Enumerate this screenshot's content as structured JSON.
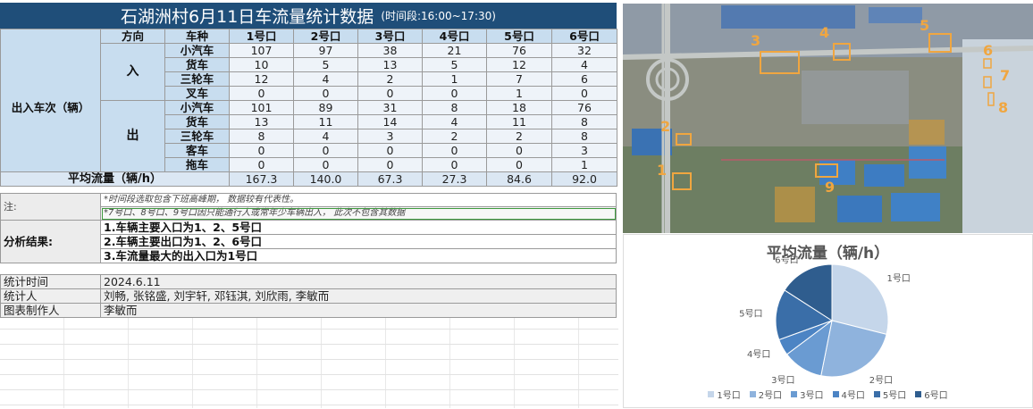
{
  "title": "石湖洲村6月11日车流量统计数据",
  "subtitle": "(时间段:16:00~17:30)",
  "table": {
    "col_direction": "方向",
    "col_type": "车种",
    "gates": [
      "1号口",
      "2号口",
      "3号口",
      "4号口",
      "5号口",
      "6号口"
    ],
    "group_label": "出入车次（辆）",
    "in_label": "入",
    "out_label": "出",
    "in_rows": [
      {
        "type": "小汽车",
        "values": [
          "107",
          "97",
          "38",
          "21",
          "76",
          "32"
        ]
      },
      {
        "type": "货车",
        "values": [
          "10",
          "5",
          "13",
          "5",
          "12",
          "4"
        ]
      },
      {
        "type": "三轮车",
        "values": [
          "12",
          "4",
          "2",
          "1",
          "7",
          "6"
        ]
      },
      {
        "type": "叉车",
        "values": [
          "0",
          "0",
          "0",
          "0",
          "1",
          "0"
        ]
      }
    ],
    "out_rows": [
      {
        "type": "小汽车",
        "values": [
          "101",
          "89",
          "31",
          "8",
          "18",
          "76"
        ]
      },
      {
        "type": "货车",
        "values": [
          "13",
          "11",
          "14",
          "4",
          "11",
          "8"
        ]
      },
      {
        "type": "三轮车",
        "values": [
          "8",
          "4",
          "3",
          "2",
          "2",
          "8"
        ]
      },
      {
        "type": "客车",
        "values": [
          "0",
          "0",
          "0",
          "0",
          "0",
          "3"
        ]
      },
      {
        "type": "拖车",
        "values": [
          "0",
          "0",
          "0",
          "0",
          "0",
          "1"
        ]
      }
    ],
    "avg_label": "平均流量（辆/h）",
    "avg_values": [
      "167.3",
      "140.0",
      "67.3",
      "27.3",
      "84.6",
      "92.0"
    ]
  },
  "notes": {
    "label": "注:",
    "line1": "*时间段选取包含下班高峰期， 数据较有代表性。",
    "line2": "*7号口、8号口、9号口因只能通行人或常年少车辆出入， 此次不包含其数据"
  },
  "analysis": {
    "label": "分析结果:",
    "lines": [
      "1.车辆主要入口为1、2、5号口",
      "2.车辆主要出口为1、2、6号口",
      "3.车流量最大的出入口为1号口"
    ]
  },
  "meta": {
    "time_label": "统计时间",
    "time_value": "2024.6.11",
    "stat_label": "统计人",
    "stat_value": "刘畅, 张铭盛, 刘宇轩, 邓钰淇, 刘欣雨, 李敏而",
    "maker_label": "图表制作人",
    "maker_value": "李敏而"
  },
  "map": {
    "gate_numbers": [
      "1",
      "2",
      "3",
      "4",
      "5",
      "6",
      "7",
      "8",
      "9"
    ],
    "box_color": "#f0a640"
  },
  "chart_data": {
    "type": "pie",
    "title": "平均流量（辆/h）",
    "categories": [
      "1号口",
      "2号口",
      "3号口",
      "4号口",
      "5号口",
      "6号口"
    ],
    "values": [
      167.3,
      140.0,
      67.3,
      27.3,
      84.6,
      92.0
    ],
    "colors": [
      "#c5d6ea",
      "#8fb3dd",
      "#6a9bd2",
      "#4c84c4",
      "#3a6ea8",
      "#2f5d8e"
    ],
    "legend": "bottom"
  }
}
